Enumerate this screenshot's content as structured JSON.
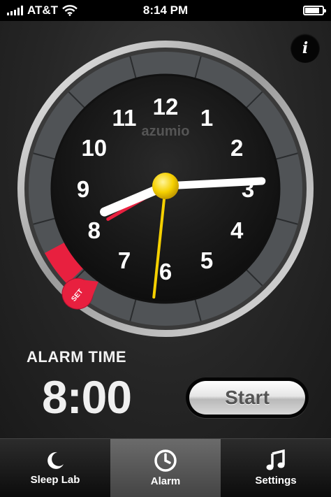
{
  "status_bar": {
    "carrier": "AT&T",
    "time": "8:14 PM"
  },
  "clock": {
    "brand": "azumio",
    "numbers": [
      "12",
      "1",
      "2",
      "3",
      "4",
      "5",
      "6",
      "7",
      "8",
      "9",
      "10",
      "11"
    ],
    "current_time": {
      "hour": 8,
      "minute": 14,
      "second": 31
    },
    "alarm_time": {
      "hour": 8,
      "minute": 0
    },
    "set_label": "SET",
    "accent_color": "#e8203f",
    "second_hand_color": "#f5d000"
  },
  "alarm": {
    "label": "ALARM TIME",
    "time": "8:00",
    "start_label": "Start"
  },
  "tabs": [
    {
      "label": "Sleep Lab",
      "icon": "moon-icon",
      "active": false
    },
    {
      "label": "Alarm",
      "icon": "clock-icon",
      "active": true
    },
    {
      "label": "Settings",
      "icon": "music-note-icon",
      "active": false
    }
  ]
}
